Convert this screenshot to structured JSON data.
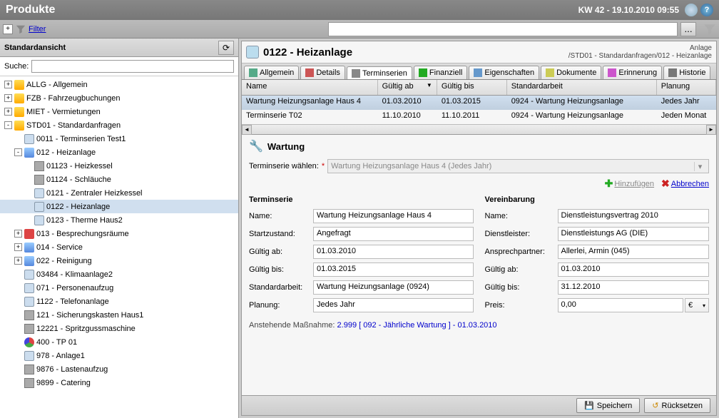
{
  "header": {
    "title": "Produkte",
    "date": "KW 42 - 19.10.2010 09:55"
  },
  "filterbar": {
    "filter_label": "Filter",
    "search_value": "",
    "browse_label": "..."
  },
  "sidebar": {
    "view_label": "Standardansicht",
    "search_label": "Suche:",
    "search_value": "",
    "tree": [
      {
        "indent": 0,
        "toggle": "+",
        "icon": "folder",
        "label": "ALLG - Allgemein"
      },
      {
        "indent": 0,
        "toggle": "+",
        "icon": "folder",
        "label": "FZB - Fahrzeugbuchungen"
      },
      {
        "indent": 0,
        "toggle": "+",
        "icon": "folder",
        "label": "MIET - Vermietungen"
      },
      {
        "indent": 0,
        "toggle": "-",
        "icon": "folder",
        "label": "STD01 - Standardanfragen"
      },
      {
        "indent": 1,
        "toggle": "",
        "icon": "leaf",
        "label": "0011 - Terminserien Test1"
      },
      {
        "indent": 1,
        "toggle": "-",
        "icon": "folder-blue",
        "label": "012 - Heizanlage"
      },
      {
        "indent": 2,
        "toggle": "",
        "icon": "gray",
        "label": "01123 - Heizkessel"
      },
      {
        "indent": 2,
        "toggle": "",
        "icon": "gray",
        "label": "01124 - Schläuche"
      },
      {
        "indent": 2,
        "toggle": "",
        "icon": "leaf",
        "label": "0121 - Zentraler Heizkessel"
      },
      {
        "indent": 2,
        "toggle": "",
        "icon": "leaf",
        "label": "0122 - Heizanlage",
        "selected": true
      },
      {
        "indent": 2,
        "toggle": "",
        "icon": "leaf",
        "label": "0123 - Therme Haus2"
      },
      {
        "indent": 1,
        "toggle": "+",
        "icon": "red",
        "label": "013 - Besprechungsräume"
      },
      {
        "indent": 1,
        "toggle": "+",
        "icon": "folder-blue",
        "label": "014 - Service"
      },
      {
        "indent": 1,
        "toggle": "+",
        "icon": "folder-blue",
        "label": "022 - Reinigung"
      },
      {
        "indent": 1,
        "toggle": "",
        "icon": "leaf",
        "label": "03484 - Klimaanlage2"
      },
      {
        "indent": 1,
        "toggle": "",
        "icon": "leaf",
        "label": "071 - Personenaufzug"
      },
      {
        "indent": 1,
        "toggle": "",
        "icon": "leaf",
        "label": "1122 - Telefonanlage"
      },
      {
        "indent": 1,
        "toggle": "",
        "icon": "gray",
        "label": "121 - Sicherungskasten Haus1"
      },
      {
        "indent": 1,
        "toggle": "",
        "icon": "gray",
        "label": "12221 - Spritzgussmaschine"
      },
      {
        "indent": 1,
        "toggle": "",
        "icon": "pie",
        "label": "400 - TP 01"
      },
      {
        "indent": 1,
        "toggle": "",
        "icon": "leaf",
        "label": "978 - Anlage1"
      },
      {
        "indent": 1,
        "toggle": "",
        "icon": "gray",
        "label": "9876 - Lastenaufzug"
      },
      {
        "indent": 1,
        "toggle": "",
        "icon": "gray",
        "label": "9899 - Catering"
      }
    ]
  },
  "panel": {
    "title": "0122 - Heizanlage",
    "meta_line1": "Anlage",
    "meta_line2": "/STD01 - Standardanfragen/012 - Heizanlage"
  },
  "tabs": [
    {
      "label": "Allgemein"
    },
    {
      "label": "Details"
    },
    {
      "label": "Terminserien",
      "active": true
    },
    {
      "label": "Finanziell"
    },
    {
      "label": "Eigenschaften"
    },
    {
      "label": "Dokumente"
    },
    {
      "label": "Erinnerung"
    },
    {
      "label": "Historie"
    }
  ],
  "grid": {
    "cols": {
      "name": "Name",
      "gab": "Gültig ab",
      "gbis": "Gültig bis",
      "std": "Standardarbeit",
      "plan": "Planung"
    },
    "rows": [
      {
        "name": "Wartung Heizungsanlage Haus 4",
        "gab": "01.03.2010",
        "gbis": "01.03.2015",
        "std": "0924 - Wartung Heizungsanlage",
        "plan": "Jedes Jahr",
        "sel": true
      },
      {
        "name": "Terminserie T02",
        "gab": "11.10.2010",
        "gbis": "11.10.2011",
        "std": "0924 - Wartung Heizungsanlage",
        "plan": "Jeden Monat"
      }
    ]
  },
  "detail": {
    "title": "Wartung",
    "select_label": "Terminserie wählen:",
    "select_value": "Wartung Heizungsanlage Haus 4 (Jedes Jahr)",
    "add_label": "Hinzufügen",
    "cancel_label": "Abbrechen",
    "left": {
      "heading": "Terminserie",
      "name_l": "Name:",
      "name_v": "Wartung Heizungsanlage Haus 4",
      "start_l": "Startzustand:",
      "start_v": "Angefragt",
      "gab_l": "Gültig ab:",
      "gab_v": "01.03.2010",
      "gbis_l": "Gültig bis:",
      "gbis_v": "01.03.2015",
      "std_l": "Standardarbeit:",
      "std_v": "Wartung Heizungsanlage (0924)",
      "plan_l": "Planung:",
      "plan_v": "Jedes Jahr"
    },
    "right": {
      "heading": "Vereinbarung",
      "name_l": "Name:",
      "name_v": "Dienstleistungsvertrag 2010",
      "dl_l": "Dienstleister:",
      "dl_v": "Dienstleistungs AG (DIE)",
      "ap_l": "Ansprechpartner:",
      "ap_v": "Allerlei, Armin (045)",
      "gab_l": "Gültig ab:",
      "gab_v": "01.03.2010",
      "gbis_l": "Gültig bis:",
      "gbis_v": "31.12.2010",
      "price_l": "Preis:",
      "price_v": "0,00",
      "cur": "€"
    },
    "pending_label": "Anstehende Maßnahme:",
    "pending_link": "2.999 [ 092 - Jährliche Wartung ] - 01.03.2010"
  },
  "buttons": {
    "save": "Speichern",
    "reset": "Rücksetzen"
  }
}
